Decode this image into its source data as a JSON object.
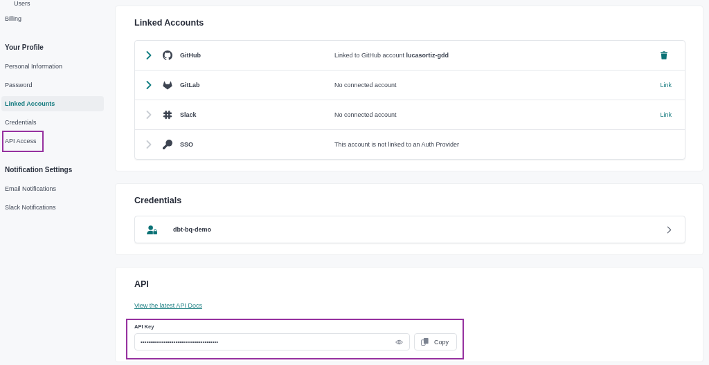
{
  "sidebar": {
    "sections": [
      {
        "items": [
          {
            "label": "Users",
            "kind": "subitem",
            "selected": false,
            "highlighted": false
          },
          {
            "label": "Billing",
            "kind": "item",
            "selected": false,
            "highlighted": false
          }
        ]
      },
      {
        "heading": "Your Profile",
        "items": [
          {
            "label": "Personal Information",
            "kind": "item",
            "selected": false,
            "highlighted": false
          },
          {
            "label": "Password",
            "kind": "item",
            "selected": false,
            "highlighted": false
          },
          {
            "label": "Linked Accounts",
            "kind": "item",
            "selected": true,
            "highlighted": false
          },
          {
            "label": "Credentials",
            "kind": "item",
            "selected": false,
            "highlighted": false
          },
          {
            "label": "API Access",
            "kind": "item",
            "selected": false,
            "highlighted": true
          }
        ]
      },
      {
        "heading": "Notification Settings",
        "items": [
          {
            "label": "Email Notifications",
            "kind": "item",
            "selected": false,
            "highlighted": false
          },
          {
            "label": "Slack Notifications",
            "kind": "item",
            "selected": false,
            "highlighted": false
          }
        ]
      }
    ]
  },
  "linked_accounts": {
    "title": "Linked Accounts",
    "rows": [
      {
        "name": "GitHub",
        "disabled": false,
        "status": "Linked to GitHub account **lucasortiz-gdd**",
        "action": {
          "kind": "delete"
        }
      },
      {
        "name": "GitLab",
        "disabled": false,
        "status": "No connected account",
        "action": {
          "kind": "link",
          "label": "Link"
        }
      },
      {
        "name": "Slack",
        "disabled": true,
        "status": "No connected account",
        "action": {
          "kind": "link",
          "label": "Link"
        }
      },
      {
        "name": "SSO",
        "disabled": true,
        "status": "This account is not linked to an Auth Provider"
      }
    ]
  },
  "credentials": {
    "title": "Credentials",
    "items": [
      {
        "name": "dbt-bq-demo"
      }
    ]
  },
  "api": {
    "title": "API",
    "docs_link": "View the latest API Docs",
    "api_key": {
      "label": "API Key",
      "value": "••••••••••••••••••••••••••••••••••••••••",
      "highlighted": true
    },
    "copy_button": "Copy"
  }
}
